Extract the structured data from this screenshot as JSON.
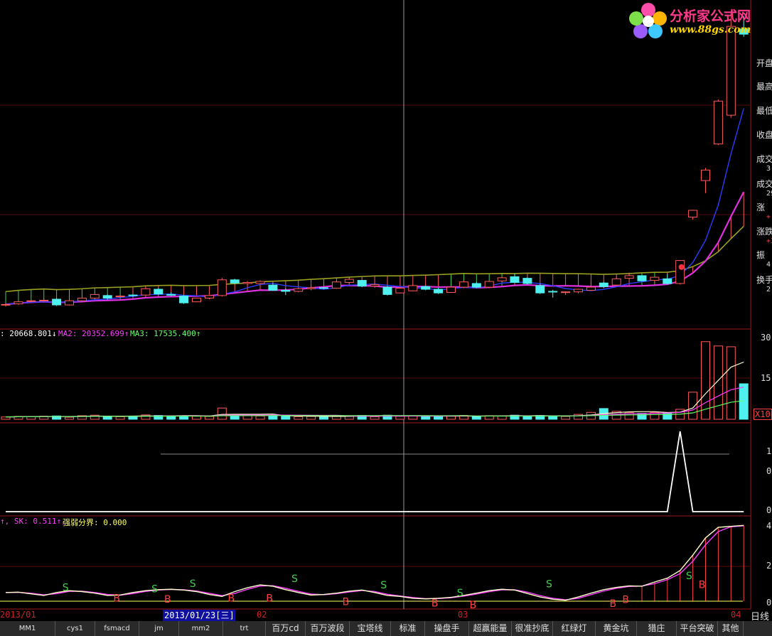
{
  "logo": {
    "title": "分析家公式网",
    "url": "www.88gs.com"
  },
  "quote_fields": [
    {
      "label": "开盘",
      "value": ""
    },
    {
      "label": "最高",
      "value": ""
    },
    {
      "label": "最低",
      "value": ""
    },
    {
      "label": "收盘",
      "value": ""
    },
    {
      "label": "成交",
      "value": "3"
    },
    {
      "label": "成交",
      "value": "29"
    },
    {
      "label": "涨",
      "value": "+"
    },
    {
      "label": "涨跌",
      "value": "+3"
    },
    {
      "label": "振",
      "value": "4"
    },
    {
      "label": "换手",
      "value": "2"
    }
  ],
  "volume_panel": {
    "ma1": ": 20668.801↓",
    "ma2": "MA2: 20352.699↑",
    "ma3": "MA3: 17535.400↑",
    "axis_top": "30",
    "axis_mid": "15",
    "axis_unit": "X10"
  },
  "signal_panel": {
    "axis_top": "1",
    "axis_mid": "0",
    "axis_bottom": "0"
  },
  "kd_panel": {
    "sk": "↑, SK: 0.511↑,",
    "divider_label": "强弱分界: 0.000",
    "axis": [
      "4",
      "2",
      "0"
    ]
  },
  "dates": {
    "jan": "2013/01",
    "cursor": "2013/01/23[三]",
    "feb": "02",
    "mar": "03",
    "apr": "04",
    "period": "日线"
  },
  "tabs": [
    "MM1",
    "cys1",
    "fsmacd",
    "jm",
    "mm2",
    "trt",
    "百万cd",
    "百万波段",
    "宝塔线",
    "标准",
    "操盘手",
    "超赢能量",
    "很准抄底",
    "红绿灯",
    "黄金坑",
    "猎庄",
    "平台突破",
    "其他"
  ],
  "chart_data": [
    {
      "type": "candlestick",
      "title": "",
      "candles_ohlc": [
        [
          30.2,
          30.5,
          29.9,
          30.3
        ],
        [
          30.4,
          30.9,
          30.2,
          30.8
        ],
        [
          30.9,
          31.1,
          30.7,
          31.0
        ],
        [
          31.0,
          31.4,
          30.8,
          31.1
        ],
        [
          31.3,
          31.5,
          30.0,
          30.2
        ],
        [
          30.2,
          31.1,
          30.1,
          31.0
        ],
        [
          31.0,
          31.6,
          30.8,
          31.5
        ],
        [
          31.5,
          32.3,
          31.3,
          32.2
        ],
        [
          32.0,
          32.2,
          31.2,
          31.5
        ],
        [
          31.8,
          32.1,
          31.6,
          31.9
        ],
        [
          32.1,
          32.3,
          31.8,
          32.0
        ],
        [
          32.1,
          33.5,
          32.0,
          33.3
        ],
        [
          33.2,
          33.4,
          32.1,
          32.3
        ],
        [
          32.2,
          32.6,
          31.9,
          32.1
        ],
        [
          31.9,
          32.1,
          30.4,
          30.6
        ],
        [
          30.8,
          31.6,
          30.7,
          31.5
        ],
        [
          31.5,
          32.1,
          31.3,
          32.0
        ],
        [
          32.0,
          35.4,
          31.8,
          35.0
        ],
        [
          35.0,
          35.2,
          34.2,
          34.4
        ],
        [
          34.3,
          34.8,
          34.0,
          34.5
        ],
        [
          34.3,
          34.9,
          34.1,
          34.7
        ],
        [
          34.0,
          34.4,
          32.9,
          33.0
        ],
        [
          33.0,
          33.4,
          32.1,
          32.8
        ],
        [
          32.8,
          33.4,
          32.6,
          33.3
        ],
        [
          33.3,
          33.8,
          33.0,
          33.5
        ],
        [
          33.5,
          33.7,
          33.2,
          33.4
        ],
        [
          33.4,
          34.8,
          33.3,
          34.6
        ],
        [
          34.5,
          35.3,
          34.3,
          35.1
        ],
        [
          34.9,
          35.0,
          33.6,
          33.8
        ],
        [
          33.8,
          34.4,
          33.5,
          34.1
        ],
        [
          33.6,
          33.9,
          32.0,
          32.2
        ],
        [
          32.5,
          33.6,
          32.4,
          33.4
        ],
        [
          32.9,
          34.2,
          32.8,
          33.9
        ],
        [
          33.7,
          33.9,
          33.0,
          33.2
        ],
        [
          33.2,
          33.5,
          32.3,
          32.5
        ],
        [
          32.6,
          33.7,
          32.5,
          33.6
        ],
        [
          33.6,
          34.9,
          33.4,
          34.6
        ],
        [
          34.3,
          34.6,
          33.4,
          33.6
        ],
        [
          33.6,
          34.8,
          33.4,
          34.7
        ],
        [
          34.8,
          35.6,
          34.6,
          35.4
        ],
        [
          35.6,
          36.2,
          34.4,
          34.5
        ],
        [
          35.3,
          35.5,
          34.1,
          34.3
        ],
        [
          33.9,
          34.3,
          32.3,
          32.5
        ],
        [
          32.8,
          33.1,
          31.6,
          32.7
        ],
        [
          32.6,
          32.8,
          32.1,
          32.7
        ],
        [
          32.7,
          33.3,
          32.4,
          33.2
        ],
        [
          33.0,
          34.8,
          32.9,
          33.6
        ],
        [
          34.4,
          34.6,
          33.4,
          33.7
        ],
        [
          34.0,
          35.4,
          33.9,
          35.2
        ],
        [
          35.3,
          36.4,
          35.2,
          35.8
        ],
        [
          35.8,
          35.9,
          34.7,
          34.8
        ],
        [
          34.9,
          35.6,
          34.5,
          35.5
        ],
        [
          35.2,
          36.1,
          34.1,
          34.3
        ],
        [
          34.3,
          38.8,
          34.1,
          38.7
        ],
        [
          47.0,
          48.4,
          46.5,
          48.3
        ],
        [
          54.0,
          56.4,
          51.6,
          56.0
        ],
        [
          61.0,
          69.5,
          60.8,
          69.2
        ],
        [
          66.5,
          86.0,
          66.0,
          83.5
        ],
        [
          83.0,
          85.5,
          81.5,
          82.0
        ]
      ],
      "ma_lines": [
        "blue",
        "magenta",
        "olive"
      ],
      "ylim": [
        26,
        88
      ]
    },
    {
      "type": "bar",
      "title": "",
      "values_x10": [
        0.9,
        1.1,
        1.0,
        1.2,
        1.3,
        0.8,
        1.4,
        1.6,
        1.1,
        1.0,
        1.2,
        1.7,
        1.5,
        1.3,
        1.4,
        1.2,
        1.1,
        4.4,
        1.6,
        1.4,
        1.3,
        1.5,
        1.2,
        1.0,
        1.1,
        0.9,
        1.3,
        1.4,
        1.5,
        1.0,
        1.6,
        1.2,
        1.4,
        1.1,
        1.0,
        1.3,
        1.5,
        1.2,
        1.4,
        1.3,
        1.6,
        1.3,
        1.5,
        1.2,
        1.1,
        1.9,
        2.7,
        4.2,
        3.1,
        2.6,
        2.3,
        2.7,
        2.5,
        3.9,
        10.6,
        30.4,
        28.7,
        28.4,
        13.9
      ],
      "ylim": [
        0,
        32
      ]
    },
    {
      "type": "line",
      "title": "",
      "values": [
        0,
        0,
        0,
        0,
        0,
        0,
        0,
        0,
        0,
        0,
        0,
        0,
        0,
        0,
        0,
        0,
        0,
        0,
        0,
        0,
        0,
        0,
        0,
        0,
        0,
        0,
        0,
        0,
        0,
        0,
        0,
        0,
        0,
        0,
        0,
        0,
        0,
        0,
        0,
        0,
        0,
        0,
        0,
        0,
        0,
        0,
        0,
        0,
        0,
        0,
        0,
        0,
        0,
        1,
        0,
        0,
        0,
        0,
        0
      ],
      "ylim": [
        0,
        1
      ]
    },
    {
      "type": "line",
      "title": "",
      "series": [
        {
          "name": "SK",
          "values": [
            0.45,
            0.47,
            0.38,
            0.3,
            0.45,
            0.55,
            0.5,
            0.42,
            0.3,
            0.32,
            0.45,
            0.55,
            0.6,
            0.62,
            0.58,
            0.5,
            0.35,
            0.25,
            0.5,
            0.7,
            0.85,
            0.78,
            0.6,
            0.45,
            0.32,
            0.35,
            0.42,
            0.52,
            0.58,
            0.45,
            0.3,
            0.25,
            0.15,
            0.12,
            0.15,
            0.2,
            0.3,
            0.42,
            0.55,
            0.62,
            0.58,
            0.4,
            0.22,
            0.1,
            0.05,
            0.22,
            0.42,
            0.6,
            0.72,
            0.8,
            0.78,
            1.0,
            1.2,
            1.6,
            2.4,
            3.3,
            3.85,
            3.9,
            3.95
          ]
        }
      ],
      "signals": [
        "S",
        "B",
        "B",
        "S",
        "B",
        "S",
        "B",
        "S",
        "B",
        "S",
        "B",
        "S",
        "B",
        "B",
        "S",
        "B",
        "S",
        "B"
      ],
      "ylim": [
        0,
        4
      ]
    }
  ]
}
